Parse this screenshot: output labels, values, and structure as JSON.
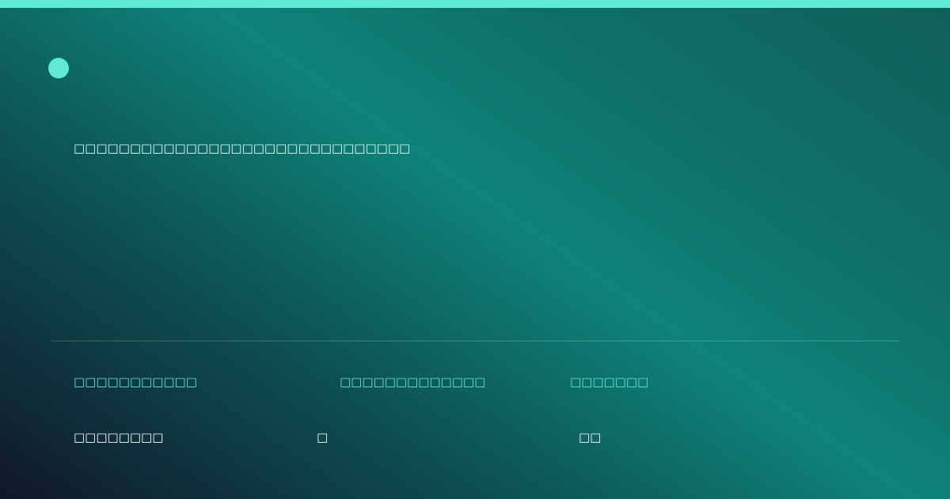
{
  "colors": {
    "accent": "#5eead4",
    "background_start": "#0f172a",
    "background_mid": "#0e837a",
    "background_end": "#115e59"
  },
  "logo": {
    "icon": "circle-dot-icon"
  },
  "subtitle": "□□□□□□□□□□□□□□□□□□□□□□□□□□□□□□",
  "stats": [
    {
      "label": "□□□□□□□□□□□",
      "value": "□□□□□□□□"
    },
    {
      "label": "□□□□□□□□□□□□□",
      "value": "□"
    },
    {
      "label": "□□□□□□□",
      "value": "□□"
    }
  ]
}
